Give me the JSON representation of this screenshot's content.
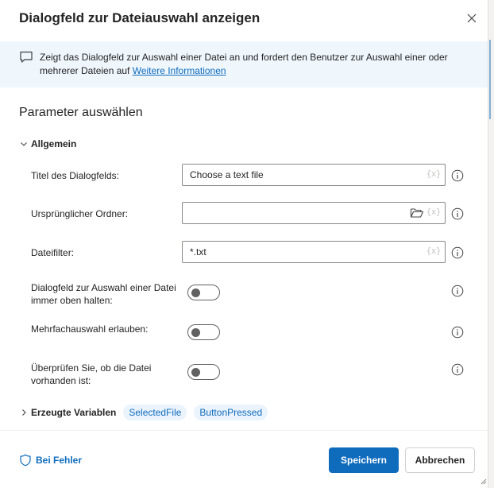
{
  "dialog": {
    "title": "Dialogfeld zur Dateiauswahl anzeigen",
    "close_icon": "close-icon"
  },
  "info": {
    "icon": "message-icon",
    "text": "Zeigt das Dialogfeld zur Auswahl einer Datei an und fordert den Benutzer zur Auswahl einer oder mehrerer Dateien auf",
    "link": "Weitere Informationen"
  },
  "parameters": {
    "section_title": "Parameter auswählen",
    "group_label": "Allgemein",
    "fields": {
      "title": {
        "label": "Titel des Dialogfelds:",
        "value": "Choose a text file",
        "token": "{x}"
      },
      "folder": {
        "label": "Ursprünglicher Ordner:",
        "value": "",
        "token": "{x}"
      },
      "filter": {
        "label": "Dateifilter:",
        "value": "*.txt",
        "token": "{x}"
      }
    },
    "toggles": {
      "on_top": {
        "label": "Dialogfeld zur Auswahl einer Datei immer oben halten:",
        "on": false
      },
      "multi": {
        "label": "Mehrfachauswahl erlauben:",
        "on": false
      },
      "exists": {
        "label": "Überprüfen Sie, ob die Datei vorhanden ist:",
        "on": false
      }
    }
  },
  "variables": {
    "label": "Erzeugte Variablen",
    "items": [
      "SelectedFile",
      "ButtonPressed"
    ]
  },
  "footer": {
    "on_error": "Bei Fehler",
    "save": "Speichern",
    "cancel": "Abbrechen"
  },
  "colors": {
    "accent": "#0f6cbd",
    "info_bar": "#eff6fc",
    "pill_bg": "#ebf3fc"
  }
}
